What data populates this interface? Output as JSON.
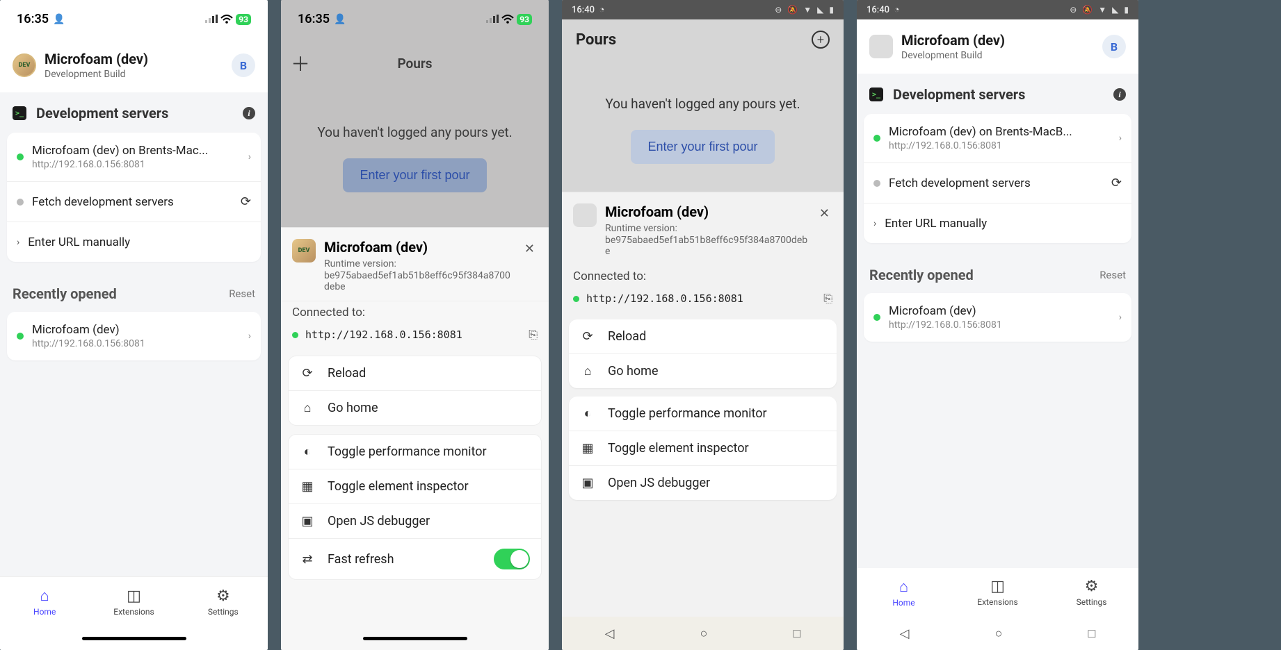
{
  "statusbar": {
    "ios_time": "16:35",
    "ios_battery": "93",
    "and_time": "16:40"
  },
  "screen1": {
    "app_title": "Microfoam (dev)",
    "app_sub": "Development Build",
    "avatar": "B",
    "section_dev": "Development servers",
    "server1_title": "Microfoam (dev) on Brents-Mac...",
    "server1_url": "http://192.168.0.156:8081",
    "fetch": "Fetch development servers",
    "enter_url": "Enter URL manually",
    "recent_title": "Recently opened",
    "reset": "Reset",
    "recent1_title": "Microfoam (dev)",
    "recent1_url": "http://192.168.0.156:8081",
    "tab_home": "Home",
    "tab_ext": "Extensions",
    "tab_set": "Settings"
  },
  "screen2": {
    "pours_title": "Pours",
    "empty_msg": "You haven't logged any pours yet.",
    "empty_btn": "Enter your first pour",
    "sheet_title": "Microfoam (dev)",
    "runtime_label": "Runtime version:",
    "runtime": "be975abaed5ef1ab51b8eff6c95f384a8700debe",
    "connected": "Connected to:",
    "connected_url": "http://192.168.0.156:8081",
    "reload": "Reload",
    "gohome": "Go home",
    "perf": "Toggle performance monitor",
    "inspect": "Toggle element inspector",
    "jsdbg": "Open JS debugger",
    "fast": "Fast refresh"
  },
  "screen3": {
    "pours_title": "Pours",
    "empty_msg": "You haven't logged any pours yet.",
    "empty_btn": "Enter your first pour",
    "sheet_title": "Microfoam (dev)",
    "runtime_label": "Runtime version:",
    "runtime": "be975abaed5ef1ab51b8eff6c95f384a8700debe",
    "connected": "Connected to:",
    "connected_url": "http://192.168.0.156:8081",
    "reload": "Reload",
    "gohome": "Go home",
    "perf": "Toggle performance monitor",
    "inspect": "Toggle element inspector",
    "jsdbg": "Open JS debugger"
  },
  "screen4": {
    "app_title": "Microfoam (dev)",
    "app_sub": "Development Build",
    "avatar": "B",
    "section_dev": "Development servers",
    "server1_title": "Microfoam (dev) on Brents-MacB...",
    "server1_url": "http://192.168.0.156:8081",
    "fetch": "Fetch development servers",
    "enter_url": "Enter URL manually",
    "recent_title": "Recently opened",
    "reset": "Reset",
    "recent1_title": "Microfoam (dev)",
    "recent1_url": "http://192.168.0.156:8081",
    "tab_home": "Home",
    "tab_ext": "Extensions",
    "tab_set": "Settings"
  }
}
